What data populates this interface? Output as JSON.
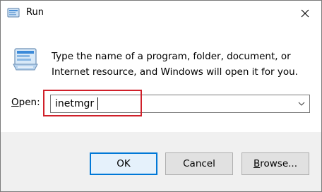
{
  "window": {
    "title": "Run",
    "title_icon": "run-dialog-icon",
    "close_icon": "close-icon"
  },
  "body": {
    "icon": "run-program-icon",
    "description_line1": "Type the name of a program, folder, document, or",
    "description_line2": "Internet resource, and Windows will open it for you."
  },
  "open_field": {
    "label_prefix": "",
    "label_accel": "O",
    "label_rest": "pen:",
    "value": "inetmgr",
    "dropdown_icon": "chevron-down-icon"
  },
  "buttons": {
    "ok": "OK",
    "cancel": "Cancel",
    "browse_accel": "B",
    "browse_rest": "rowse..."
  },
  "colors": {
    "highlight_border": "#d0202a",
    "default_button_border": "#0078d7",
    "footer_bg": "#f0f0f0"
  }
}
